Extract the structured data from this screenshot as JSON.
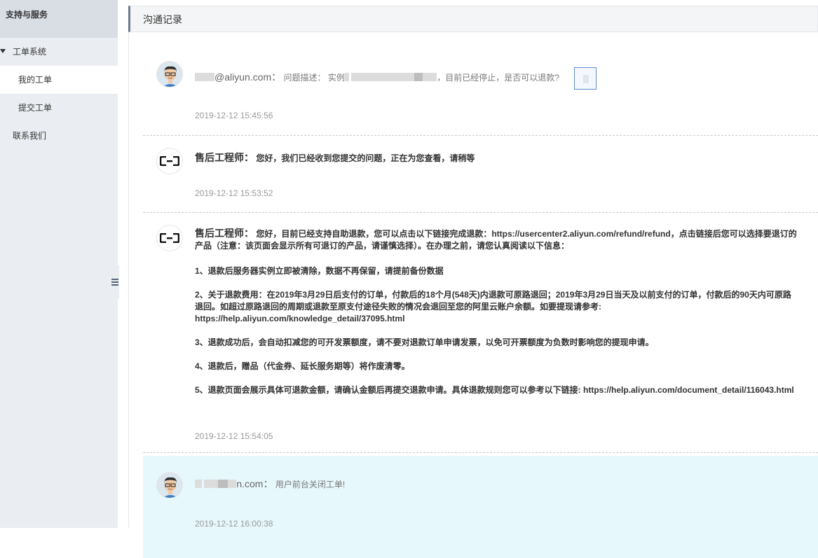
{
  "sidebar": {
    "title": "支持与服务",
    "group": "工单系统",
    "items": [
      {
        "label": "我的工单"
      },
      {
        "label": "提交工单"
      }
    ],
    "contact": "联系我们"
  },
  "panel": {
    "title": "沟通记录"
  },
  "records": [
    {
      "author_suffix": "@aliyun.com",
      "colon": "：",
      "label": "问题描述：",
      "text_prefix": "实例",
      "text_suffix": "，目前已经停止，是否可以退款?",
      "timestamp": "2019-12-12 15:45:56"
    },
    {
      "author": "售后工程师：",
      "text": "您好，我们已经收到您提交的问题，正在为您查看，请稍等",
      "timestamp": "2019-12-12 15:53:52"
    },
    {
      "author": "售后工程师：",
      "intro": "您好，目前已经支持自助退款，您可以点击以下链接完成退款：https://usercenter2.aliyun.com/refund/refund，点击链接后您可以选择要退订的产品（注意：该页面会显示所有可退订的产品，请谨慎选择）。在办理之前，请您认真阅读以下信息：",
      "points": [
        "1、退款后服务器实例立即被清除，数据不再保留，请提前备份数据",
        "2、关于退款费用：在2019年3月29日后支付的订单，付款后的18个月(548天)内退款可原路退回；2019年3月29日当天及以前支付的订单，付款后的90天内可原路退回。如超过原路退回的周期或退款至原支付途径失败的情况会退回至您的阿里云账户余额。如要提现请参考: https://help.aliyun.com/knowledge_detail/37095.html",
        "3、退款成功后，会自动扣减您的可开发票额度，请不要对退款订单申请发票，以免可开票额度为负数时影响您的提现申请。",
        "4、退款后，赠品（代金券、延长服务期等）将作废清零。",
        "5、退款页面会展示具体可退款金额，请确认金额后再提交退款申请。具体退款规则您可以参考以下链接: https://help.aliyun.com/document_detail/116043.html"
      ],
      "timestamp": "2019-12-12 15:54:05"
    },
    {
      "author_suffix": "n.com",
      "colon": "：",
      "text": "用户前台关闭工单!",
      "timestamp": "2019-12-12 16:00:38"
    }
  ],
  "colors": {
    "highlight_bg": "#e6f8fc",
    "sidebar_bg": "#eaedf1",
    "accent_border": "#6b7a8f"
  }
}
